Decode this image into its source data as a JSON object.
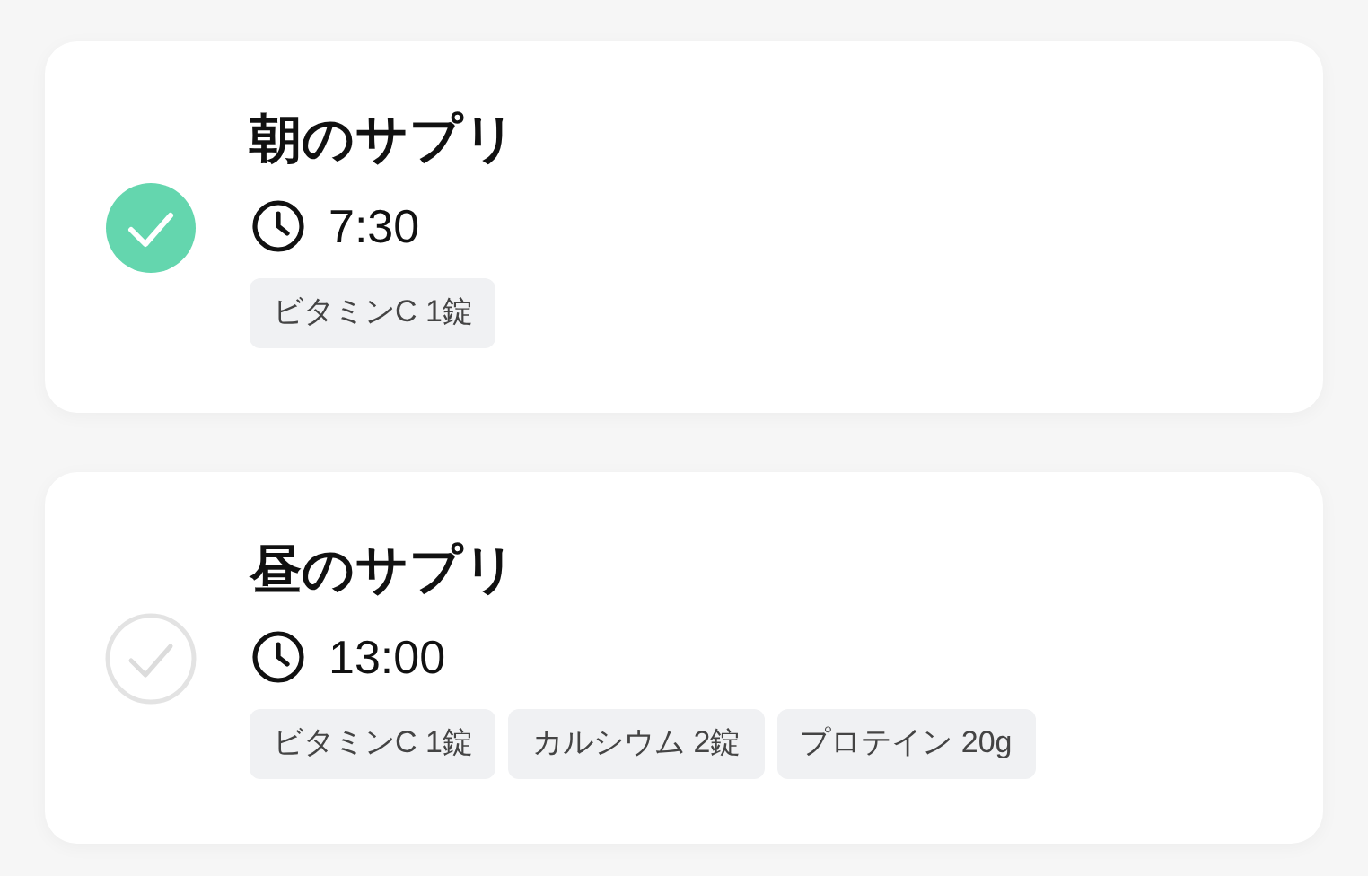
{
  "reminders": [
    {
      "title": "朝のサプリ",
      "time": "7:30",
      "taken": true,
      "items": [
        "ビタミンC 1錠"
      ]
    },
    {
      "title": "昼のサプリ",
      "time": "13:00",
      "taken": false,
      "items": [
        "ビタミンC 1錠",
        "カルシウム 2錠",
        "プロテイン 20g"
      ]
    }
  ]
}
